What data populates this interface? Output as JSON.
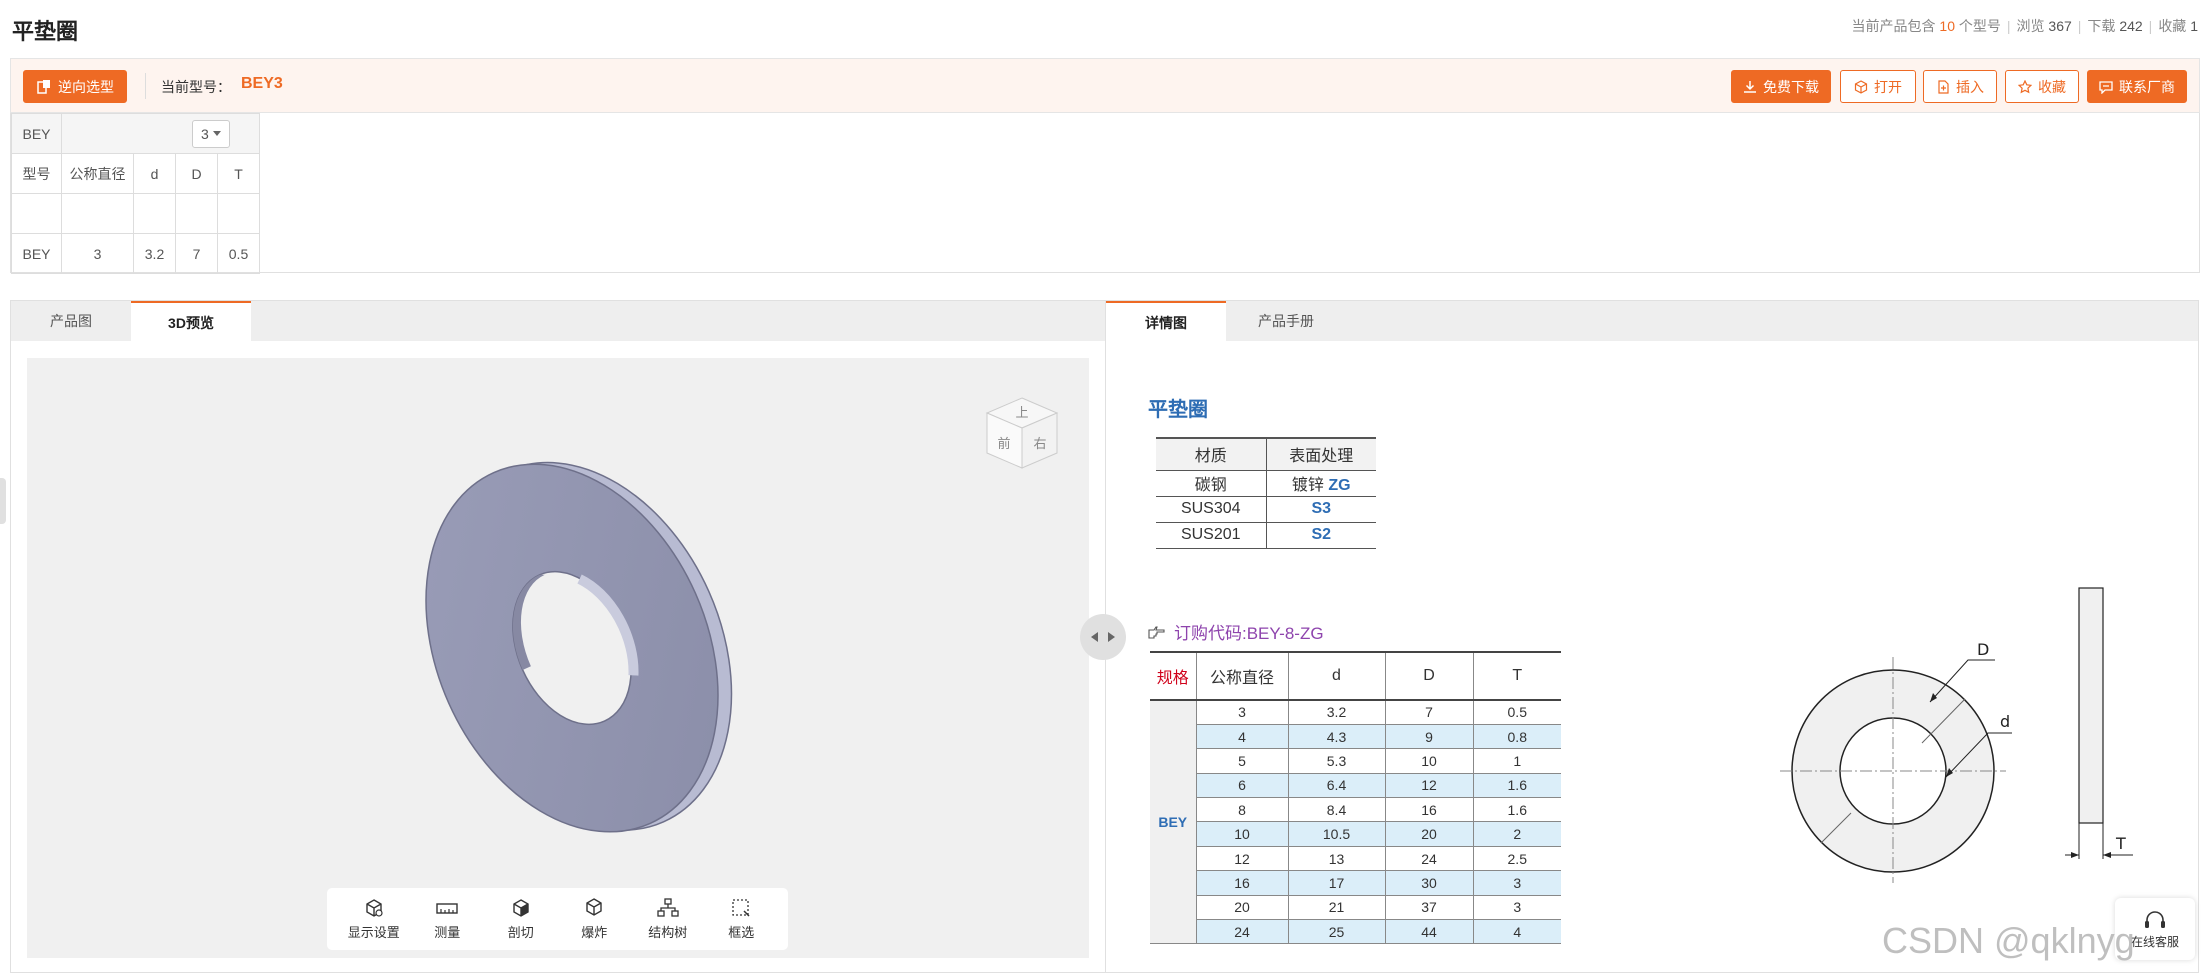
{
  "header": {
    "title": "平垫圈",
    "stats": {
      "prefix": "当前产品包含",
      "model_count": "10",
      "model_suffix": "个型号",
      "views_label": "浏览",
      "views": "367",
      "downloads_label": "下载",
      "downloads": "242",
      "favorites_label": "收藏",
      "favorites": "1"
    }
  },
  "toolbar": {
    "reverse_select": "逆向选型",
    "current_label": "当前型号：",
    "current_model": "BEY3",
    "download": "免费下载",
    "open": "打开",
    "insert": "插入",
    "favorite": "收藏",
    "contact": "联系厂商"
  },
  "params": {
    "series": "BEY",
    "selected_size": "3",
    "headers": [
      "型号",
      "公称直径",
      "d",
      "D",
      "T"
    ],
    "row": [
      "BEY",
      "3",
      "3.2",
      "7",
      "0.5"
    ]
  },
  "left_panel": {
    "tabs": [
      "产品图",
      "3D预览"
    ],
    "active_tab": "3D预览",
    "viewcube": {
      "top": "上",
      "front": "前",
      "right": "右"
    },
    "tools": [
      "显示设置",
      "测量",
      "剖切",
      "爆炸",
      "结构树",
      "框选"
    ]
  },
  "right_panel": {
    "tabs": [
      "详情图",
      "产品手册"
    ],
    "active_tab": "详情图",
    "title": "平垫圈",
    "material_table": {
      "headers": [
        "材质",
        "表面处理"
      ],
      "rows": [
        {
          "material": "碳钢",
          "treatment": "镀锌",
          "code": "ZG"
        },
        {
          "material": "SUS304",
          "treatment": "",
          "code": "S3"
        },
        {
          "material": "SUS201",
          "treatment": "",
          "code": "S2"
        }
      ]
    },
    "order_code": "订购代码:BEY-8-ZG",
    "spec_table": {
      "label": "规格",
      "series": "BEY",
      "headers": [
        "公称直径",
        "d",
        "D",
        "T"
      ],
      "rows": [
        [
          "3",
          "3.2",
          "7",
          "0.5"
        ],
        [
          "4",
          "4.3",
          "9",
          "0.8"
        ],
        [
          "5",
          "5.3",
          "10",
          "1"
        ],
        [
          "6",
          "6.4",
          "12",
          "1.6"
        ],
        [
          "8",
          "8.4",
          "16",
          "1.6"
        ],
        [
          "10",
          "10.5",
          "20",
          "2"
        ],
        [
          "12",
          "13",
          "24",
          "2.5"
        ],
        [
          "16",
          "17",
          "30",
          "3"
        ],
        [
          "20",
          "21",
          "37",
          "3"
        ],
        [
          "24",
          "25",
          "44",
          "4"
        ]
      ]
    },
    "drawing_labels": {
      "outer": "D",
      "inner": "d",
      "thickness": "T"
    }
  },
  "support": {
    "label": "在线客服"
  },
  "watermark": "CSDN @qklnyg"
}
